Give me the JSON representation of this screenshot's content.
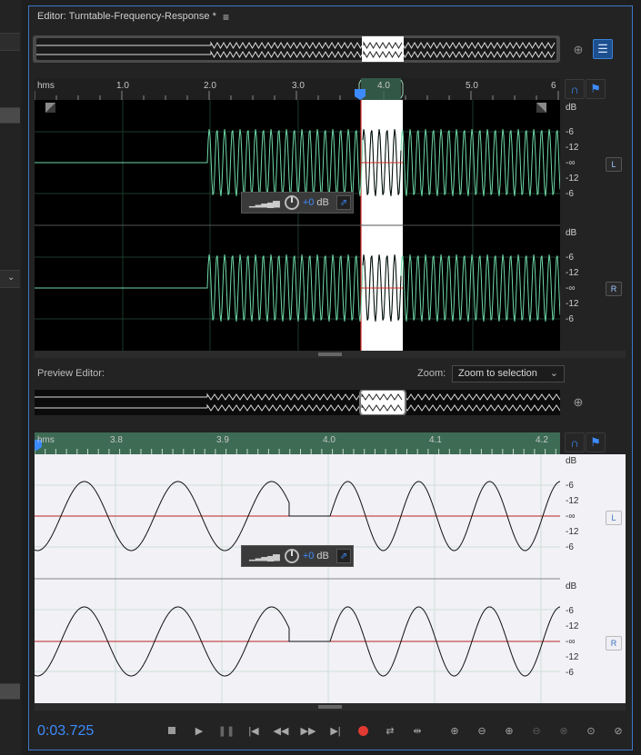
{
  "editor": {
    "title": "Editor: Turntable-Frequency-Response *",
    "menu_icon": "hamburger-menu-icon"
  },
  "main_ruler": {
    "unit": "hms",
    "ticks": [
      "1.0",
      "2.0",
      "3.0",
      "4.0",
      "5.0",
      "6"
    ]
  },
  "main_channels": {
    "db_label": "dB",
    "scale": [
      "-6",
      "-12",
      "-∞",
      "-12",
      "-6"
    ],
    "left_badge": "L",
    "right_badge": "R"
  },
  "main_hud": {
    "gain": "+0",
    "unit": "dB"
  },
  "preview": {
    "label": "Preview Editor:",
    "zoom_label": "Zoom:",
    "zoom_value": "Zoom to selection"
  },
  "preview_ruler": {
    "unit": "hms",
    "ticks": [
      "3.8",
      "3.9",
      "4.0",
      "4.1",
      "4.2"
    ]
  },
  "preview_channels": {
    "db_label": "dB",
    "scale": [
      "-6",
      "-12",
      "-∞",
      "-12",
      "-6"
    ],
    "left_badge": "L",
    "right_badge": "R"
  },
  "preview_hud": {
    "gain": "+0",
    "unit": "dB"
  },
  "transport": {
    "time": "0:03.725",
    "buttons": [
      "stop-icon",
      "play-icon",
      "pause-icon",
      "go-to-start-icon",
      "rewind-icon",
      "fast-forward-icon",
      "go-to-end-icon",
      "record-icon",
      "loop-icon",
      "skip-selection-icon"
    ],
    "zoom_buttons": [
      "zoom-in-amplitude-icon",
      "zoom-out-amplitude-icon",
      "zoom-in-time-icon",
      "zoom-out-time-icon",
      "zoom-out-full-icon",
      "zoom-in-point-icon",
      "zoom-selection-icon"
    ]
  },
  "colors": {
    "waveform": "#6fd9a8",
    "selection": "#ffffff",
    "accent": "#3d8bff",
    "playhead": "#d0302a"
  }
}
